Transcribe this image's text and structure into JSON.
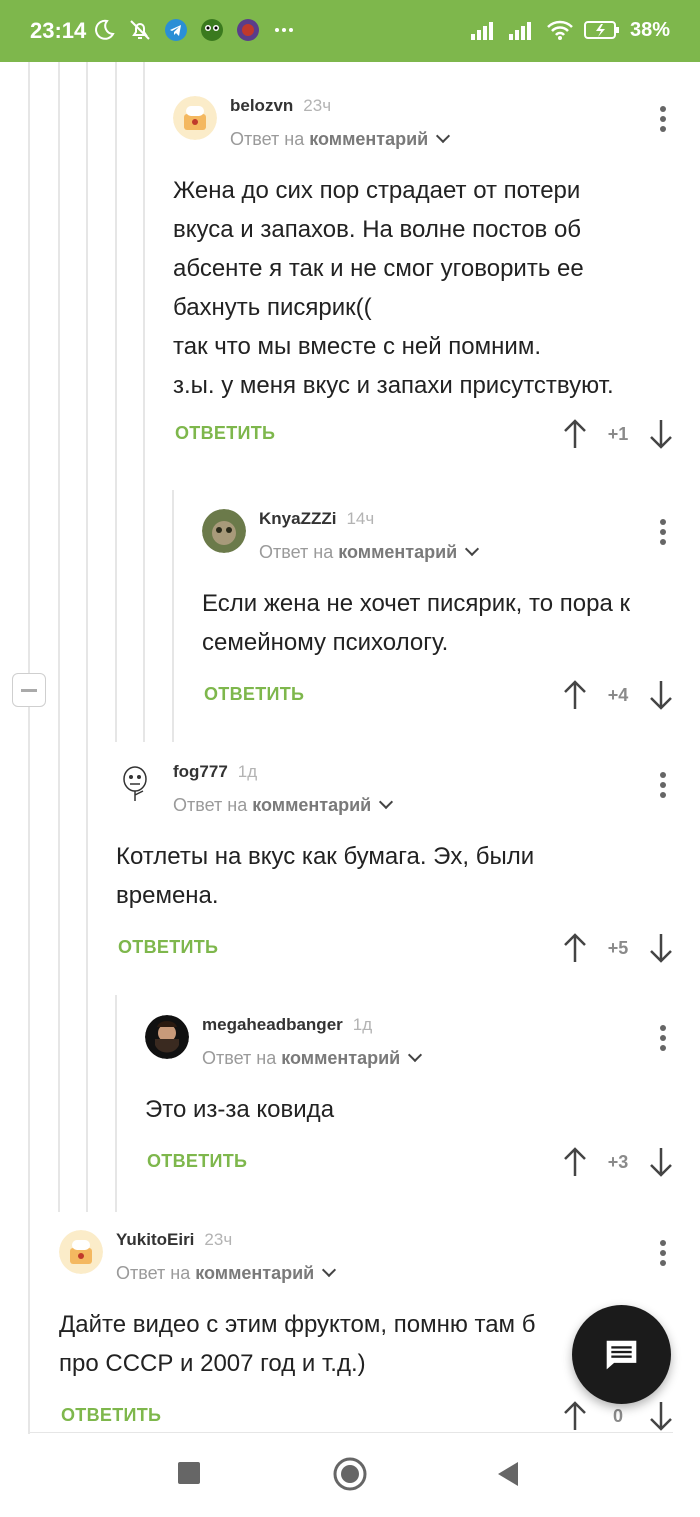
{
  "status_bar": {
    "time": "23:14",
    "battery": "38%",
    "icons": [
      "moon-icon",
      "mute-icon",
      "telegram-icon",
      "frog-app-icon",
      "game-app-icon",
      "more-dots-icon",
      "signal-icon",
      "signal-icon",
      "wifi-icon",
      "battery-icon"
    ]
  },
  "comments": [
    {
      "username": "belozvn",
      "time": "23ч",
      "reply_prefix": "Ответ на",
      "reply_target": "комментарий",
      "body": [
        "Жена до сих пор страдает от потери",
        "вкуса и запахов. На волне постов об",
        "абсенте я так и не смог уговорить ее",
        "бахнуть писярик((",
        "так что мы вместе с ней помним.",
        "з.ы. у меня вкус и запахи присутствуют."
      ],
      "reply_label": "ОТВЕТИТЬ",
      "score": "+1"
    },
    {
      "username": "KnyaZZZi",
      "time": "14ч",
      "reply_prefix": "Ответ на",
      "reply_target": "комментарий",
      "body": [
        "Если жена не хочет писярик, то пора к",
        "семейному психологу."
      ],
      "reply_label": "ОТВЕТИТЬ",
      "score": "+4"
    },
    {
      "username": "fog777",
      "time": "1д",
      "reply_prefix": "Ответ на",
      "reply_target": "комментарий",
      "body": [
        "Котлеты на вкус как бумага. Эх, были",
        "времена."
      ],
      "reply_label": "ОТВЕТИТЬ",
      "score": "+5"
    },
    {
      "username": "megaheadbanger",
      "time": "1д",
      "reply_prefix": "Ответ на",
      "reply_target": "комментарий",
      "body": [
        "Это из-за ковида"
      ],
      "reply_label": "ОТВЕТИТЬ",
      "score": "+3"
    },
    {
      "username": "YukitoEiri",
      "time": "23ч",
      "reply_prefix": "Ответ на",
      "reply_target": "комментарий",
      "body": [
        "Дайте видео с этим фруктом, помню там б",
        "про СССР и 2007 год и т.д.)"
      ],
      "reply_label": "ОТВЕТИТЬ",
      "score": "0"
    }
  ],
  "colors": {
    "accent": "#7eb74c",
    "text": "#222222",
    "muted": "#9a9a9a"
  }
}
